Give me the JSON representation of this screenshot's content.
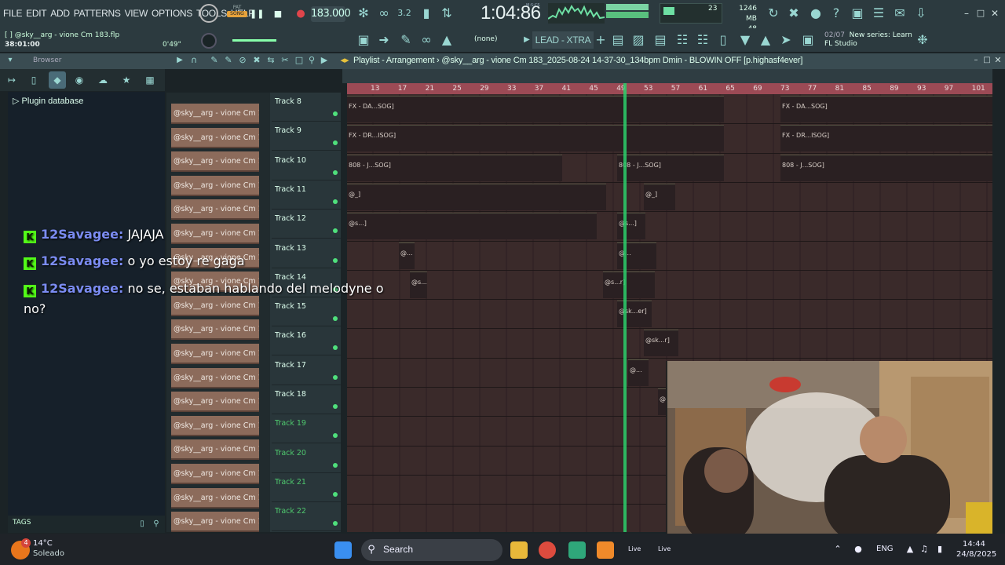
{
  "menu": [
    "FILE",
    "EDIT",
    "ADD",
    "PATTERNS",
    "VIEW",
    "OPTIONS",
    "TOOLS",
    "HELP"
  ],
  "transport": {
    "pat_label": "PAT",
    "song_label": "SONG",
    "tempo": "183.000",
    "time": "1:04:86",
    "time_unit": "M:S:CS",
    "cpu": "23",
    "memory": "1246 MB",
    "polyphony": "48"
  },
  "project": {
    "filename": "[ ]  @sky__arg - vione Cm 183.flp",
    "elapsed": "38:01:00",
    "offset": "0'49\""
  },
  "snap_selector": "(none)",
  "preset": "LEAD - XTRA",
  "news": {
    "count": "02/07",
    "text": "New series: Learn",
    "source": "FL Studio"
  },
  "browser": {
    "title": "Browser",
    "plugin_database": "Plugin database",
    "tags_label": "TAGS"
  },
  "playlist_title": "Playlist - Arrangement  ›  @sky__arg - vione Cm 183_2025-08-24 14-37-30_134bpm Dmin - BLOWIN OFF [p.highasf4ever]",
  "chat": [
    {
      "user": "12Savagee:",
      "message": "JAJAJA"
    },
    {
      "user": "12Savagee:",
      "message": "o yo estoy re gaga"
    },
    {
      "user": "12Savagee:",
      "message": "no se, estaban hablando del melodyne o no?"
    }
  ],
  "clip_list": [
    "@sky__arg - vione Cm 18...",
    "@sky__arg - vione Cm 18...",
    "@sky__arg - vione Cm 18...",
    "@sky__arg - vione Cm 18...",
    "@sky__arg - vione Cm 18...",
    "@sky__arg - vione Cm 18...",
    "@sky__arg - vione Cm 18...",
    "@sky__arg - vione Cm 18...",
    "@sky__arg - vione Cm 18...",
    "@sky__arg - vione Cm 18...",
    "@sky__arg - vione Cm 18...",
    "@sky__arg - vione Cm 18...",
    "@sky__arg - vione Cm 18...",
    "@sky__arg - vione Cm 18...",
    "@sky__arg - vione Cm 18...",
    "@sky__arg - vione Cm 18...",
    "@sky__arg - vione Cm 18...",
    "@sky__arg - vione Cm 18..."
  ],
  "tracks": [
    "Track 8",
    "Track 9",
    "Track 10",
    "Track 11",
    "Track 12",
    "Track 13",
    "Track 14",
    "Track 15",
    "Track 16",
    "Track 17",
    "Track 18",
    "Track 19",
    "Track 20",
    "Track 21",
    "Track 22"
  ],
  "bar_numbers": [
    "13",
    "17",
    "21",
    "25",
    "29",
    "33",
    "37",
    "41",
    "45",
    "49",
    "53",
    "57",
    "61",
    "65",
    "69",
    "73",
    "77",
    "81",
    "85",
    "89",
    "93",
    "97",
    "101"
  ],
  "clip_labels": {
    "fx_da": "FX - DA...SOG]",
    "fx_dr": "FX - DR...ISOG]",
    "fx_d": "FX - D...ISOG]",
    "fx_d_end": "FX - D...SOG]",
    "b808": "808 - J...SOG]",
    "b808_end": "808 - ...SOG]",
    "at_sk": "@sk...r]",
    "at_sk2": "@s...r]",
    "at_sk3": "@sk...er]",
    "at_short": "@_]",
    "at_s": "@s...]",
    "at_plain": "@..."
  },
  "taskbar": {
    "weather_badge": "4",
    "temp": "14°C",
    "weather": "Soleado",
    "search": "Search",
    "app1": "Live",
    "app2": "Live",
    "lang": "ENG",
    "time": "14:44",
    "date": "24/8/2025"
  }
}
